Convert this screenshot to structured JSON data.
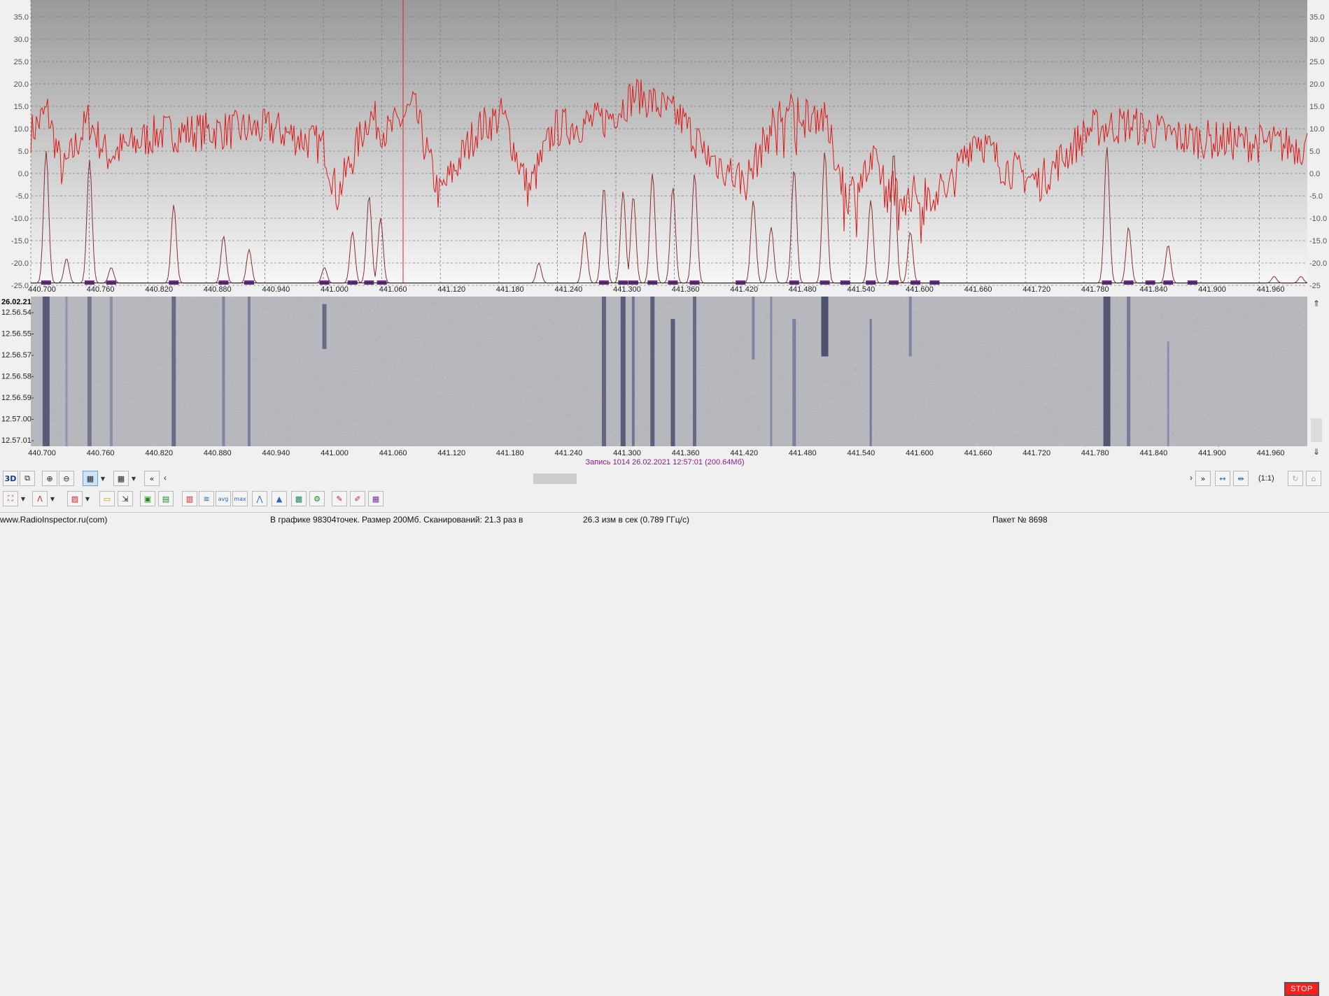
{
  "spectrum": {
    "y_ticks": [
      "35.0",
      "30.0",
      "25.0",
      "20.0",
      "15.0",
      "10.0",
      "5.0",
      "0.0",
      "-5.0",
      "-10.0",
      "-15.0",
      "-20.0",
      "-25.0"
    ],
    "y_ticks_right": [
      "35.0",
      "30.0",
      "25.0",
      "20.0",
      "15.0",
      "10.0",
      "5.0",
      "0.0",
      "-5.0",
      "-10.0",
      "-15.0",
      "-20.0",
      "-25"
    ],
    "x_ticks": [
      "440.700",
      "440.760",
      "440.820",
      "440.880",
      "440.940",
      "441.000",
      "441.060",
      "441.120",
      "441.180",
      "441.240",
      "441.300",
      "441.360",
      "441.420",
      "441.480",
      "441.540",
      "441.600",
      "441.660",
      "441.720",
      "441.780",
      "441.840",
      "441.900",
      "441.960"
    ],
    "colors": {
      "trace": "#e01818",
      "envelope": "#8b2e2e",
      "marker": "#6a2c8c",
      "grid": "#7a7a7a"
    }
  },
  "waterfall": {
    "date": "26.02.21",
    "times": [
      "12.56.54-",
      "12.56.55-",
      "12.56.57-",
      "12.56.58-",
      "12.56.59-",
      "12.57.00-",
      "12.57.01-"
    ],
    "x_ticks": [
      "440.700",
      "440.760",
      "440.820",
      "440.880",
      "440.940",
      "441.000",
      "441.060",
      "441.120",
      "441.180",
      "441.240",
      "441.300",
      "441.360",
      "441.420",
      "441.480",
      "441.540",
      "441.600",
      "441.660",
      "441.720",
      "441.780",
      "441.840",
      "441.900",
      "441.960"
    ],
    "record_info": "Запись 1014 26.02.2021 12:57:01 (200.64Мб)"
  },
  "toolbar1": {
    "btn_3d": "3D",
    "zoom_label": "(1:1)"
  },
  "toolbar2": {
    "stop_label": "STOP"
  },
  "statusbar": {
    "site": "www.RadioInspector.ru(com)",
    "info": "В графике 98304точек.  Размер 200Мб. Сканирований: 21.3 раз в",
    "rate": "26.3 изм в сек (0.789 ГГц/с)",
    "packet": "Пакет № 8698"
  }
}
